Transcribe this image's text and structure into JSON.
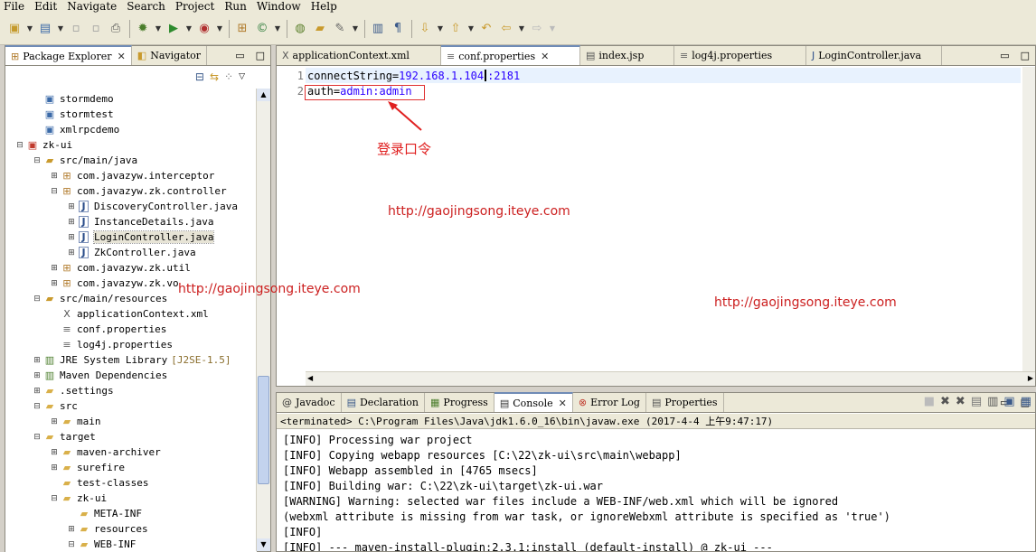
{
  "menu": [
    "File",
    "Edit",
    "Navigate",
    "Search",
    "Project",
    "Run",
    "Window",
    "Help"
  ],
  "package_explorer": {
    "tabs": [
      {
        "label": "Package Explorer",
        "icon": "package-icon",
        "close": "✕"
      },
      {
        "label": "Navigator",
        "icon": "navigator-icon"
      }
    ],
    "tree": [
      {
        "level": 1,
        "twist": "",
        "icon": "project-icon",
        "label": "stormdemo"
      },
      {
        "level": 1,
        "twist": "",
        "icon": "project-icon",
        "label": "stormtest"
      },
      {
        "level": 1,
        "twist": "",
        "icon": "project-icon",
        "label": "xmlrpcdemo"
      },
      {
        "level": 0,
        "twist": "⊟",
        "icon": "maven-project-icon",
        "label": "zk-ui"
      },
      {
        "level": 1,
        "twist": "⊟",
        "icon": "source-folder-icon",
        "label": "src/main/java"
      },
      {
        "level": 2,
        "twist": "⊞",
        "icon": "package-icon",
        "label": "com.javazyw.interceptor"
      },
      {
        "level": 2,
        "twist": "⊟",
        "icon": "package-icon",
        "label": "com.javazyw.zk.controller"
      },
      {
        "level": 3,
        "twist": "⊞",
        "icon": "java-file-icon",
        "label": "DiscoveryController.java"
      },
      {
        "level": 3,
        "twist": "⊞",
        "icon": "java-file-icon",
        "label": "InstanceDetails.java"
      },
      {
        "level": 3,
        "twist": "⊞",
        "icon": "java-file-icon",
        "label": "LoginController.java",
        "selected": true
      },
      {
        "level": 3,
        "twist": "⊞",
        "icon": "java-file-icon",
        "label": "ZkController.java"
      },
      {
        "level": 2,
        "twist": "⊞",
        "icon": "package-icon",
        "label": "com.javazyw.zk.util"
      },
      {
        "level": 2,
        "twist": "⊞",
        "icon": "package-icon",
        "label": "com.javazyw.zk.vo"
      },
      {
        "level": 1,
        "twist": "⊟",
        "icon": "source-folder-icon",
        "label": "src/main/resources"
      },
      {
        "level": 2,
        "twist": "",
        "icon": "xml-file-icon",
        "label": "applicationContext.xml"
      },
      {
        "level": 2,
        "twist": "",
        "icon": "text-file-icon",
        "label": "conf.properties"
      },
      {
        "level": 2,
        "twist": "",
        "icon": "text-file-icon",
        "label": "log4j.properties"
      },
      {
        "level": 1,
        "twist": "⊞",
        "icon": "library-icon",
        "label": "JRE System Library",
        "decoration": "[J2SE-1.5]"
      },
      {
        "level": 1,
        "twist": "⊞",
        "icon": "library-icon",
        "label": "Maven Dependencies"
      },
      {
        "level": 1,
        "twist": "⊞",
        "icon": "folder-icon",
        "label": ".settings"
      },
      {
        "level": 1,
        "twist": "⊟",
        "icon": "folder-icon",
        "label": "src"
      },
      {
        "level": 2,
        "twist": "⊞",
        "icon": "folder-icon",
        "label": "main"
      },
      {
        "level": 1,
        "twist": "⊟",
        "icon": "folder-icon",
        "label": "target"
      },
      {
        "level": 2,
        "twist": "⊞",
        "icon": "folder-icon",
        "label": "maven-archiver"
      },
      {
        "level": 2,
        "twist": "⊞",
        "icon": "folder-icon",
        "label": "surefire"
      },
      {
        "level": 2,
        "twist": "",
        "icon": "folder-icon",
        "label": "test-classes"
      },
      {
        "level": 2,
        "twist": "⊟",
        "icon": "folder-icon",
        "label": "zk-ui"
      },
      {
        "level": 3,
        "twist": "",
        "icon": "folder-icon",
        "label": "META-INF"
      },
      {
        "level": 3,
        "twist": "⊞",
        "icon": "folder-icon",
        "label": "resources"
      },
      {
        "level": 3,
        "twist": "⊟",
        "icon": "folder-icon",
        "label": "WEB-INF"
      }
    ]
  },
  "editor": {
    "tabs": [
      {
        "label": "applicationContext.xml",
        "icon": "xml-file-icon"
      },
      {
        "label": "conf.properties",
        "icon": "text-file-icon",
        "active": true,
        "close": "✕"
      },
      {
        "label": "index.jsp",
        "icon": "jsp-file-icon"
      },
      {
        "label": "log4j.properties",
        "icon": "text-file-icon"
      },
      {
        "label": "LoginController.java",
        "icon": "java-file-icon"
      }
    ],
    "lines": [
      {
        "num": "1",
        "key": "connectString=",
        "value_a": "192.168.1.104",
        "value_b": ":2181"
      },
      {
        "num": "2",
        "key": "auth=",
        "value_a": "admin:admin",
        "value_b": ""
      }
    ],
    "annotation": "登录口令"
  },
  "watermark": "http://gaojingsong.iteye.com",
  "console": {
    "tabs": [
      {
        "label": "Javadoc",
        "icon": "at-icon"
      },
      {
        "label": "Declaration",
        "icon": "declaration-icon"
      },
      {
        "label": "Progress",
        "icon": "progress-icon"
      },
      {
        "label": "Console",
        "icon": "console-icon",
        "active": true,
        "close": "✕"
      },
      {
        "label": "Error Log",
        "icon": "error-log-icon"
      },
      {
        "label": "Properties",
        "icon": "properties-icon"
      }
    ],
    "terminated": "<terminated> C:\\Program Files\\Java\\jdk1.6.0_16\\bin\\javaw.exe (2017-4-4 上午9:47:17)",
    "lines": [
      "[INFO] Processing war project",
      "[INFO] Copying webapp resources [C:\\22\\zk-ui\\src\\main\\webapp]",
      "[INFO] Webapp assembled in [4765 msecs]",
      "[INFO] Building war: C:\\22\\zk-ui\\target\\zk-ui.war",
      "[WARNING] Warning: selected war files include a WEB-INF/web.xml which will be ignored",
      "(webxml attribute is missing from war task, or ignoreWebxml attribute is specified as 'true')",
      "[INFO]",
      "[INFO] --- maven-install-plugin:2.3.1:install (default-install) @ zk-ui ---"
    ]
  }
}
